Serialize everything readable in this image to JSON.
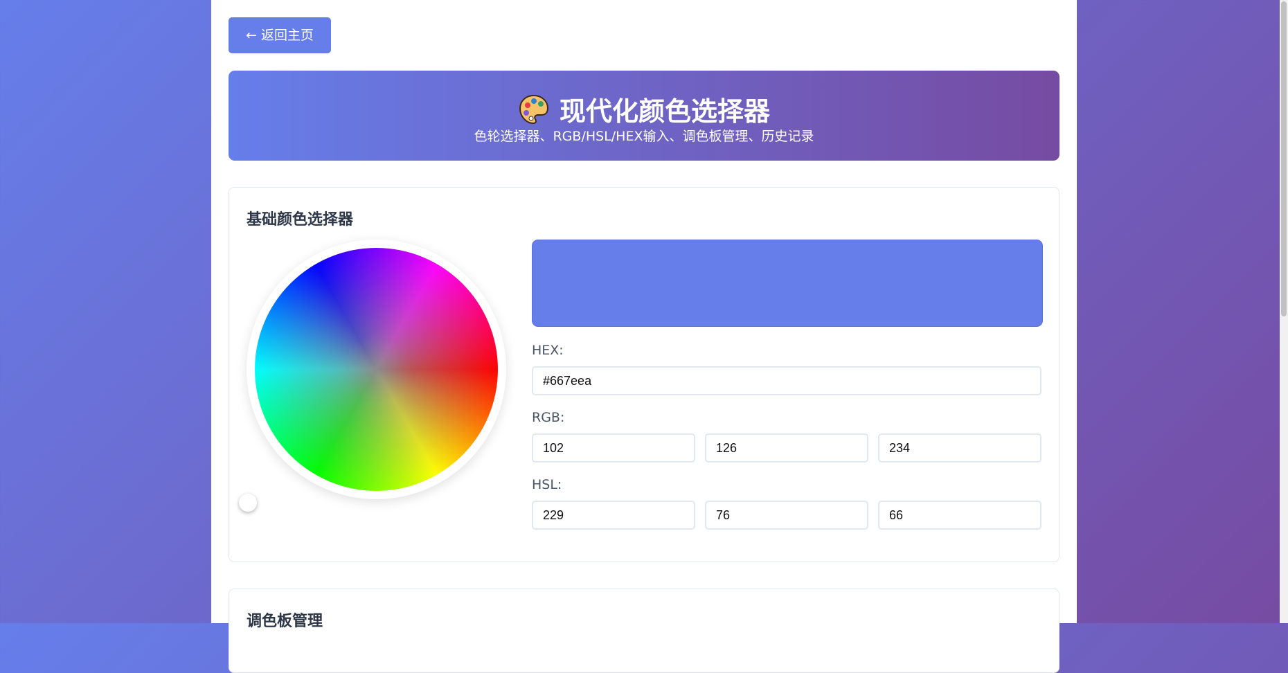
{
  "back_button": {
    "label": "← 返回主页"
  },
  "header": {
    "title": "现代化颜色选择器",
    "subtitle": "色轮选择器、RGB/HSL/HEX输入、调色板管理、历史记录",
    "icon": "palette-icon"
  },
  "basic_picker": {
    "title": "基础颜色选择器",
    "preview_color": "#667eea",
    "hex_label": "HEX:",
    "hex_value": "#667eea",
    "rgb_label": "RGB:",
    "rgb": {
      "r": "102",
      "g": "126",
      "b": "234"
    },
    "hsl_label": "HSL:",
    "hsl": {
      "h": "229",
      "s": "76",
      "l": "66"
    }
  },
  "palette_section": {
    "title": "调色板管理"
  },
  "colors": {
    "accent": "#667eea",
    "gradient_end": "#764ba2"
  }
}
